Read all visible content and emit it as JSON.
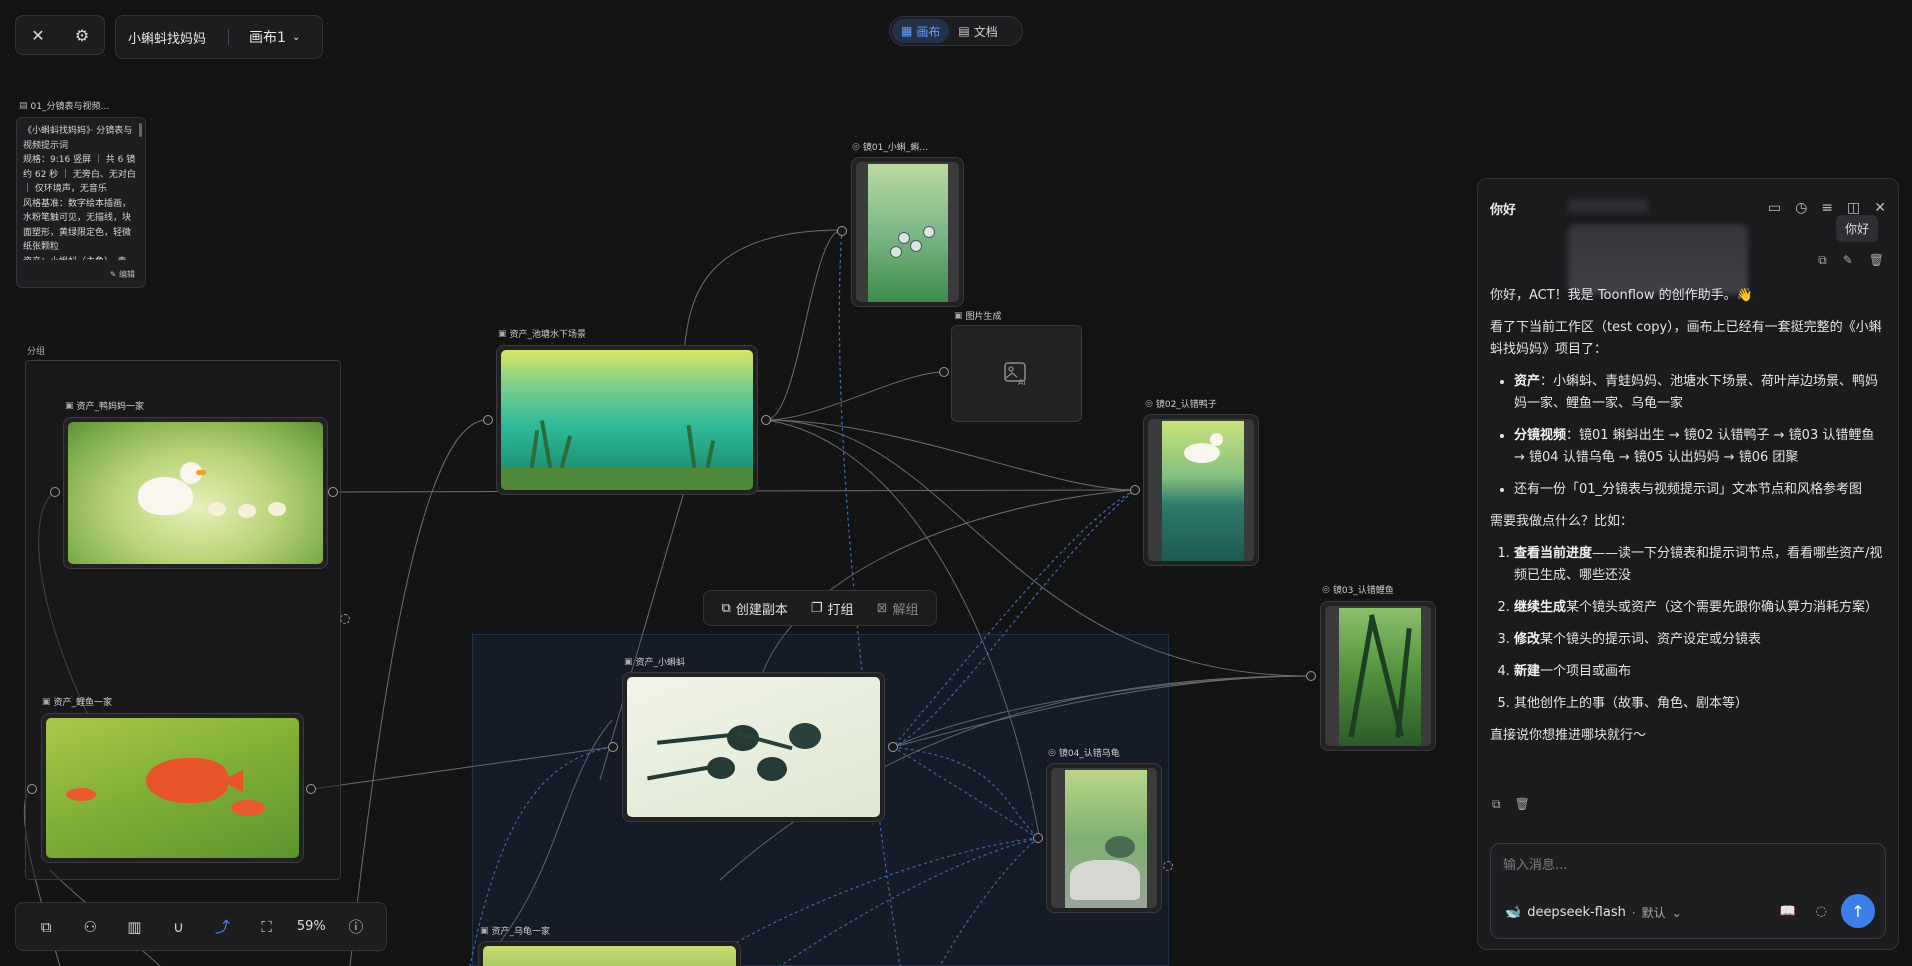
{
  "header": {
    "project_name": "小蝌蚪找妈妈",
    "canvas_name": "画布1",
    "mode_tabs": [
      {
        "label": "画布",
        "active": true
      },
      {
        "label": "文档",
        "active": false
      }
    ]
  },
  "text_node": {
    "title": "01_分镜表与视频…",
    "body": "《小蝌蚪找妈妈》· 分镜表与视频提示词\n规格：9:16 竖屏 ｜ 共 6 镜约 62 秒 ｜ 无旁白、无对白 ｜ 仅环境声，无音乐\n风格基准：数字绘本插画，水粉笔触可见，无描线，块面塑形，黄绿限定色，轻微纸张颗粒\n资产：小蝌蚪（主角）、青",
    "edit_label": "编辑"
  },
  "group": {
    "label": "分组"
  },
  "nodes": {
    "duck_family": "资产_鸭妈妈一家",
    "carp_family": "资产_鲤鱼一家",
    "pond": "资产_池塘水下场景",
    "tadpole": "资产_小蝌蚪",
    "turtle_family": "资产_乌龟一家",
    "shot01": "镜01_小蝌_蝌…",
    "image_gen": "图片生成",
    "shot02": "镜02_认错鸭子",
    "shot03": "镜03_认错鲤鱼",
    "shot04": "镜04_认错乌龟"
  },
  "context_toolbar": {
    "duplicate": "创建副本",
    "group": "打组",
    "ungroup": "解组"
  },
  "bottom_toolbar": {
    "zoom": "59%",
    "icons": [
      "copy-icon",
      "hierarchy-icon",
      "map-icon",
      "magnet-icon",
      "connector-icon",
      "fit-screen-icon"
    ]
  },
  "chat": {
    "title": "你好",
    "tooltip": "你好",
    "greeting": "你好，ACT！我是 Toonflow 的创作助手。👋",
    "intro": "看了下当前工作区（test copy），画布上已经有一套挺完整的《小蝌蚪找妈妈》项目了：",
    "bullets": [
      {
        "bold": "资产",
        "text": "：小蝌蚪、青蛙妈妈、池塘水下场景、荷叶岸边场景、鸭妈妈一家、鲤鱼一家、乌龟一家"
      },
      {
        "bold": "分镜视频",
        "text": "：镜01 蝌蚪出生 → 镜02 认错鸭子 → 镜03 认错鲤鱼 → 镜04 认错乌龟 → 镜05 认出妈妈 → 镜06 团聚"
      },
      {
        "bold": "",
        "text": "还有一份「01_分镜表与视频提示词」文本节点和风格参考图"
      }
    ],
    "question": "需要我做点什么？比如：",
    "options": [
      {
        "bold": "查看当前进度",
        "text": "——读一下分镜表和提示词节点，看看哪些资产/视频已生成、哪些还没"
      },
      {
        "bold": "继续生成",
        "text": "某个镜头或资产（这个需要先跟你确认算力消耗方案）"
      },
      {
        "bold": "修改",
        "text": "某个镜头的提示词、资产设定或分镜表"
      },
      {
        "bold": "新建",
        "text": "一个项目或画布"
      },
      {
        "bold": "",
        "text": "其他创作上的事（故事、角色、剧本等）"
      }
    ],
    "closing": "直接说你想推进哪块就行～",
    "input_placeholder": "输入消息...",
    "model": "deepseek-flash",
    "model_mode": "默认"
  },
  "colors": {
    "accent": "#4a8dff",
    "send_button": "#3d7fe8",
    "background": "#131314",
    "panel": "#1d1d20"
  }
}
